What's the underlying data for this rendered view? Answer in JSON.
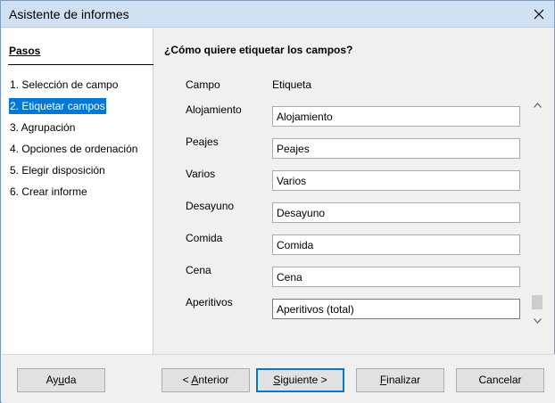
{
  "window": {
    "title": "Asistente de informes"
  },
  "steps": {
    "title": "Pasos",
    "items": [
      {
        "label": "1. Selección de campo",
        "active": false
      },
      {
        "label": "2. Etiquetar campos",
        "active": true
      },
      {
        "label": "3. Agrupación",
        "active": false
      },
      {
        "label": "4. Opciones de ordenación",
        "active": false
      },
      {
        "label": "5. Elegir disposición",
        "active": false
      },
      {
        "label": "6. Crear informe",
        "active": false
      }
    ]
  },
  "main": {
    "question": "¿Cómo quiere etiquetar los campos?",
    "column_field": "Campo",
    "column_label": "Etiqueta",
    "fields": [
      {
        "name": "Alojamiento",
        "value": "Alojamiento"
      },
      {
        "name": "Peajes",
        "value": "Peajes"
      },
      {
        "name": "Varios",
        "value": "Varios"
      },
      {
        "name": "Desayuno",
        "value": "Desayuno"
      },
      {
        "name": "Comida",
        "value": "Comida"
      },
      {
        "name": "Cena",
        "value": "Cena"
      },
      {
        "name": "Aperitivos",
        "value": "Aperitivos (total)"
      }
    ]
  },
  "buttons": {
    "help_pre": "Ay",
    "help_key": "u",
    "help_post": "da",
    "back_pre": "< ",
    "back_key": "A",
    "back_post": "nterior",
    "next_pre": "",
    "next_key": "S",
    "next_post": "iguiente >",
    "finish_pre": "",
    "finish_key": "F",
    "finish_post": "inalizar",
    "cancel_label": "Cancelar"
  },
  "icons": {
    "close": "close-icon",
    "scroll_up": "chevron-up-icon",
    "scroll_down": "chevron-down-icon"
  },
  "colors": {
    "titlebar": "#cfe0f3",
    "selection": "#0078d7",
    "default_button_border": "#0078d7"
  }
}
